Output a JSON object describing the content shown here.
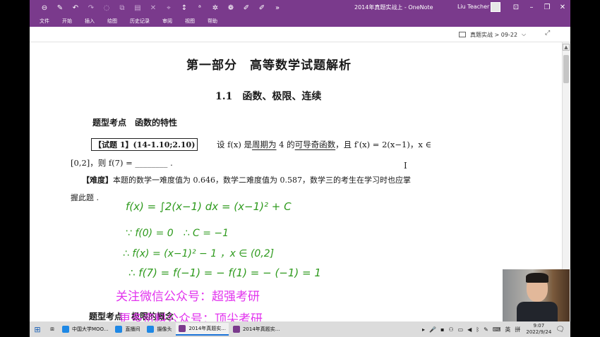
{
  "titlebar": {
    "doc_title": "2014年真题实战上 - OneNote",
    "user_name": "Liu Teacher",
    "qat_icons": [
      "back-icon",
      "pen-icon",
      "undo-icon",
      "redo-icon",
      "lasso-icon",
      "eraser-icon",
      "highlighter-icon"
    ]
  },
  "menu": [
    "文件",
    "开始",
    "插入",
    "绘图",
    "历史记录",
    "审阅",
    "视图",
    "帮助"
  ],
  "breadcrumb": "真题实战 > 09-22",
  "page": {
    "part_title": "第一部分　高等数学试题解析",
    "section_title": "1.1　函数、极限、连续",
    "topic_heading": "题型考点　函数的特性",
    "question_box": "【试题 1】(14-1.10;2.10)",
    "question_prefix": "设 f(x) 是",
    "question_u1": "周期为",
    "question_mid1": " 4 的",
    "question_u2": "可导奇函数",
    "question_suffix": "，且 f′(x) = 2(x−1)，x ∈",
    "question_line2": "[0,2]，则 f(7) = ________ .",
    "difficulty_label": "【难度】",
    "difficulty_text": "本题的数学一难度值为 0.646，数学二难度值为 0.587，数学三的考生在学习时也应掌",
    "difficulty_text_2": "握此题 .",
    "topic_heading_2": "题型考点　极限的概念"
  },
  "handwriting": {
    "line1": "f(x) = ∫2(x−1) dx = (x−1)² + C",
    "line2": "∵ f(0) = 0　∴ C = −1",
    "line3": "∴ f(x) = (x−1)² − 1 ，x ∈ (0,2]",
    "line4": "∴ f(7) = f(−1) = − f(1) = − (−1) = 1"
  },
  "watermarks": {
    "wm1": "关注微信公众号：超强考研",
    "wm2": "更多资料公众号：顶尖考研"
  },
  "taskbar": {
    "apps": [
      {
        "label": "中国大学MOO...",
        "color": "#1e88e5"
      },
      {
        "label": "直播间",
        "color": "#1e88e5"
      },
      {
        "label": "摄像头",
        "color": "#1e88e5"
      },
      {
        "label": "2014年真题实...",
        "color": "#7a3a8c"
      },
      {
        "label": "2014年真题实...",
        "color": "#7a3a8c"
      }
    ],
    "ime": "英",
    "ime2": "拼",
    "time": "9:07",
    "date": "2022/9/24"
  }
}
